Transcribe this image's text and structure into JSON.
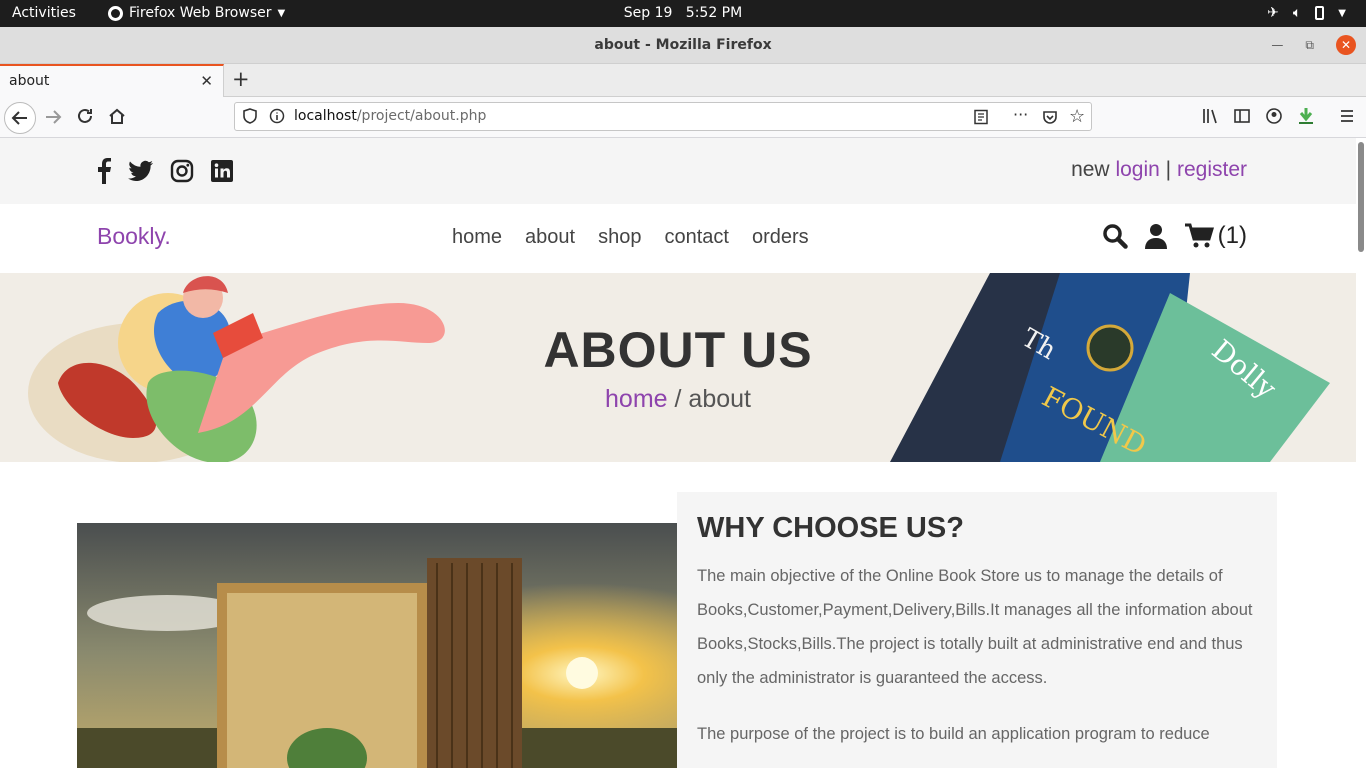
{
  "system": {
    "activities": "Activities",
    "app_name": "Firefox Web Browser",
    "date": "Sep 19",
    "time": "5:52 PM"
  },
  "browser": {
    "window_title": "about - Mozilla Firefox",
    "tab_title": "about",
    "url_host": "localhost",
    "url_path": "/project/about.php"
  },
  "site": {
    "logo": "Bookly.",
    "auth": {
      "prefix": "new",
      "login": "login",
      "sep": "|",
      "register": "register"
    },
    "nav": [
      "home",
      "about",
      "shop",
      "contact",
      "orders"
    ],
    "cart_count": "(1)",
    "social_icons": [
      "facebook-icon",
      "twitter-icon",
      "instagram-icon",
      "linkedin-icon"
    ],
    "accent": "#8e44ad"
  },
  "banner": {
    "heading": "ABOUT US",
    "crumb_home": "home",
    "crumb_sep": "/",
    "crumb_current": "about"
  },
  "about": {
    "heading": "WHY CHOOSE US?",
    "p1": "The main objective of the Online Book Store us to manage the details of Books,Customer,Payment,Delivery,Bills.It manages all the information about Books,Stocks,Bills.The project is totally built at administrative end and thus only the administrator is guaranteed the access.",
    "p2": "The purpose of the project is to build an application program to reduce"
  }
}
